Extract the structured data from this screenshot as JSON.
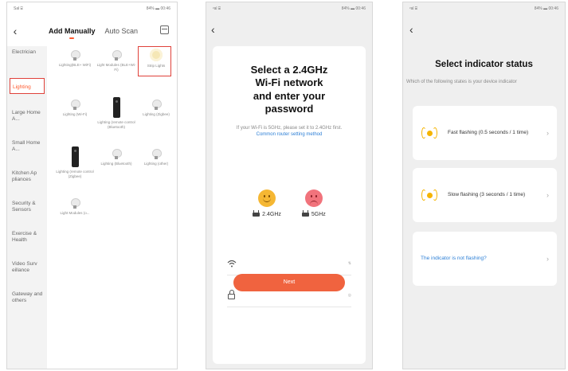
{
  "screen1": {
    "status_left": "Sal ⌸",
    "status_right": "84% ▬ 00:46",
    "back_icon": "chevron-left-icon",
    "tabs": [
      {
        "label": "Add Manually",
        "active": true
      },
      {
        "label": "Auto Scan",
        "active": false
      }
    ],
    "scan_icon": "scan-icon",
    "sidebar": [
      {
        "label": "Electrician",
        "selected": false
      },
      {
        "label": "Lighting",
        "selected": true
      },
      {
        "label": "Large Home A...",
        "selected": false
      },
      {
        "label": "Small Home A...",
        "selected": false
      },
      {
        "label": "Kitchen Ap pliances",
        "selected": false
      },
      {
        "label": "Security & Sensors",
        "selected": false
      },
      {
        "label": "Exercise & Health",
        "selected": false
      },
      {
        "label": "Video Surv eillance",
        "selected": false
      },
      {
        "label": "Gateway and others",
        "selected": false
      }
    ],
    "devices": [
      {
        "label": "Lighting(BLE+ WiFi)",
        "icon": "bulb"
      },
      {
        "label": "Light Modules (BLE+Wi-Fi)",
        "icon": "bulb"
      },
      {
        "label": "Strip Lights",
        "icon": "strip-light",
        "highlighted": true
      },
      {
        "label": "Lighting (Wi-Fi)",
        "icon": "bulb"
      },
      {
        "label": "Lighting (remote control (Bluetooth)",
        "icon": "strip"
      },
      {
        "label": "Lighting (Zigbee)",
        "icon": "bulb"
      },
      {
        "label": "Lighting (remote control (Zigbee)",
        "icon": "strip"
      },
      {
        "label": "Lighting (Bluetooth)",
        "icon": "bulb"
      },
      {
        "label": "Lighting (other)",
        "icon": "bulb"
      },
      {
        "label": "Light Modules (o...",
        "icon": "bulb"
      }
    ]
  },
  "screen2": {
    "status_left": "ᵛal ⌸",
    "status_right": "84% ▬ 00:46",
    "back_icon": "chevron-left-icon",
    "title_lines": [
      "Select a 2.4GHz",
      "Wi-Fi network",
      "and enter your",
      "password"
    ],
    "note_text": "If your Wi-Fi is 5GHz, please set it to 2.4GHz first.",
    "note_link": "Common router setting method",
    "bands": [
      {
        "label": "2.4GHz",
        "face": "happy"
      },
      {
        "label": "5GHz",
        "face": "sad"
      }
    ],
    "wifi_field": {
      "icon": "wifi-icon",
      "value": "",
      "tail": "⇅"
    },
    "password_field": {
      "icon": "lock-icon",
      "value": "",
      "tail": "◎"
    },
    "next_label": "Next"
  },
  "screen3": {
    "status_left": "ᵛal ⌸",
    "status_right": "84% ▬ 00:46",
    "back_icon": "chevron-left-icon",
    "title": "Select indicator status",
    "subtitle": "Which of the following states is your device indicator",
    "options": [
      {
        "text": "Fast flashing (0.5 seconds / 1 time)",
        "icon": "indicator-icon",
        "is_link": false
      },
      {
        "text": "Slow flashing (3 seconds / 1 time)",
        "icon": "indicator-icon",
        "is_link": false
      },
      {
        "text": "The indicator is not flashing?",
        "icon": "",
        "is_link": true
      }
    ],
    "chevron": "›"
  },
  "colors": {
    "accent": "#f0633f",
    "highlight": "#e0413a",
    "link": "#2c7fd6",
    "indicator": "#f5b400"
  }
}
